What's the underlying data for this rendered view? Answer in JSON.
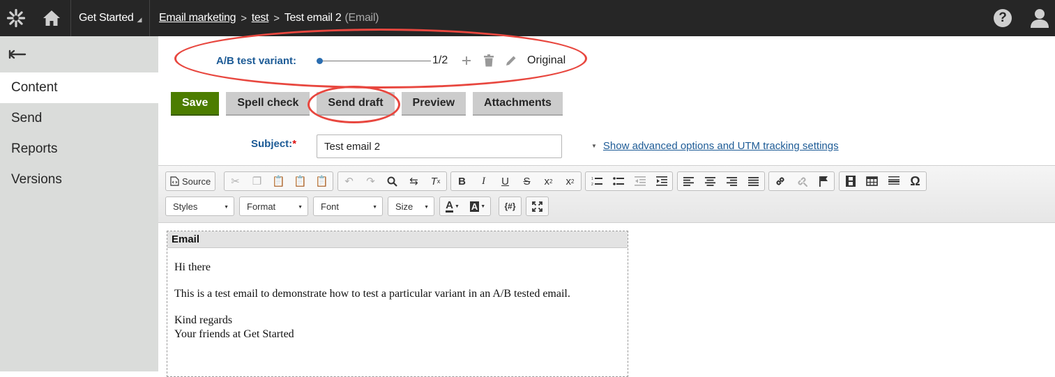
{
  "topbar": {
    "app_menu": "Get Started",
    "breadcrumb": {
      "item1": "Email marketing",
      "item2": "test",
      "current": "Test email 2",
      "type": "(Email)"
    },
    "help_glyph": "?"
  },
  "sidebar": {
    "items": [
      {
        "label": "Content"
      },
      {
        "label": "Send"
      },
      {
        "label": "Reports"
      },
      {
        "label": "Versions"
      }
    ]
  },
  "ab_test": {
    "label": "A/B test variant:",
    "count": "1/2",
    "variant_name": "Original",
    "slider_position": 0
  },
  "actions": {
    "save": "Save",
    "spell_check": "Spell check",
    "send_draft": "Send draft",
    "preview": "Preview",
    "attachments": "Attachments"
  },
  "subject": {
    "label": "Subject:",
    "required_mark": "*",
    "value": "Test email 2"
  },
  "advanced_link": "Show advanced options and UTM tracking settings",
  "editor": {
    "source": "Source",
    "styles": "Styles",
    "format": "Format",
    "font": "Font",
    "size": "Size",
    "macro": "{#}",
    "text_color_glyph": "A",
    "bg_color_glyph": "A",
    "italic": "I",
    "bold": "B",
    "underline": "U",
    "strike": "S",
    "omega": "Ω"
  },
  "region": {
    "title": "Email",
    "greeting": "Hi there",
    "paragraph": "This is a test email to demonstrate how to test a particular variant in an A/B tested email.",
    "closing_1": "Kind regards",
    "closing_2": "Your friends at Get Started"
  },
  "colors": {
    "topbar": "#262626",
    "sidebar": "#dadcda",
    "accent_blue": "#1d5b96",
    "save_green": "#4c7d00",
    "highlight_red": "#e8473f"
  }
}
